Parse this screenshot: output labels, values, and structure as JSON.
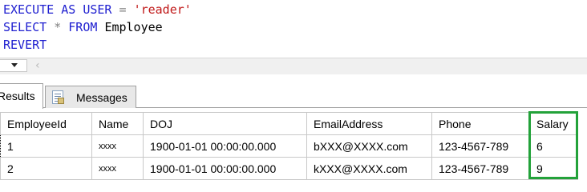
{
  "editor": {
    "line1": {
      "kw1": "EXECUTE AS USER",
      "op": "=",
      "str": "'reader'"
    },
    "line2": {
      "kw1": "SELECT",
      "op": "*",
      "kw2": "FROM",
      "id": "Employee"
    },
    "line3": {
      "kw1": "REVERT"
    }
  },
  "tabs": {
    "results": "Results",
    "messages": "Messages"
  },
  "grid": {
    "headers": [
      "EmployeeId",
      "Name",
      "DOJ",
      "EmailAddress",
      "Phone",
      "Salary"
    ],
    "rows": [
      [
        "1",
        "xxxx",
        "1900-01-01 00:00:00.000",
        "bXXX@XXXX.com",
        "123-4567-789",
        "6"
      ],
      [
        "2",
        "xxxx",
        "1900-01-01 00:00:00.000",
        "kXXX@XXXX.com",
        "123-4567-789",
        "9"
      ]
    ]
  },
  "colors": {
    "keyword": "#2020d0",
    "string": "#c01818",
    "operator": "#808080",
    "highlight": "#23a23a"
  },
  "icons": {
    "zoom": "chevron-down-icon",
    "scroll": "scroll-left-icon",
    "messages": "messages-icon"
  }
}
